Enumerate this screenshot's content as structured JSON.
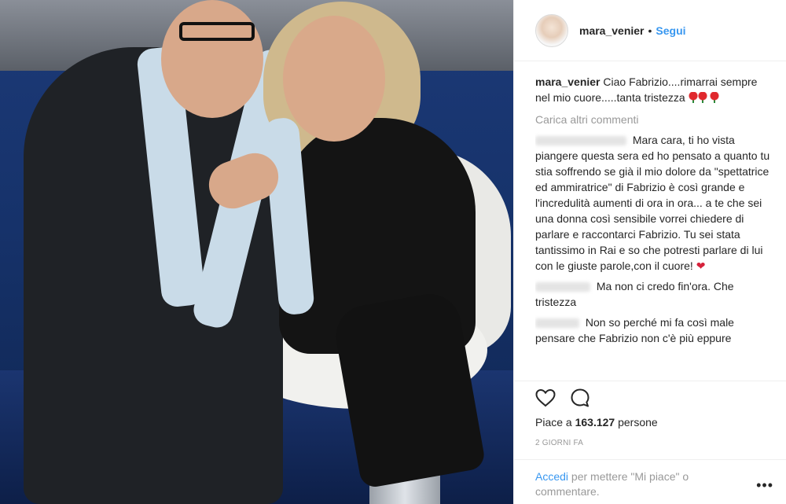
{
  "post": {
    "username": "mara_venier",
    "separator": "•",
    "follow_label": "Segui"
  },
  "caption": {
    "username": "mara_venier",
    "text": "Ciao Fabrizio....rimarrai sempre nel mio cuore.....tanta tristezza"
  },
  "load_more_label": "Carica altri commenti",
  "comments": [
    {
      "text": "Mara cara, ti ho vista piangere questa sera ed ho pensato a quanto tu stia soffrendo se già il mio dolore da \"spettatrice ed ammiratrice\" di Fabrizio è così grande e l'incredulità aumenti di ora in ora... a te che sei una donna così sensibile vorrei chiedere di parlare e raccontarci Fabrizio. Tu sei stata tantissimo in Rai e so che potresti parlare di lui con le giuste parole,con il cuore!"
    },
    {
      "text": "Ma non ci credo fin'ora. Che tristezza"
    },
    {
      "text": "Non so perché mi fa così male pensare che Fabrizio non c'è più eppure"
    }
  ],
  "likes": {
    "prefix": "Piace a ",
    "count": "163.127",
    "suffix": " persone"
  },
  "timestamp": "2 GIORNI FA",
  "footer": {
    "login_link": "Accedi",
    "login_rest": " per mettere \"Mi piace\" o commentare.",
    "more_label": "•••"
  },
  "icons": {
    "like": "heart-icon",
    "comment": "comment-icon"
  },
  "colors": {
    "link_blue": "#3897f0",
    "muted_gray": "#999999",
    "text": "#262626"
  }
}
